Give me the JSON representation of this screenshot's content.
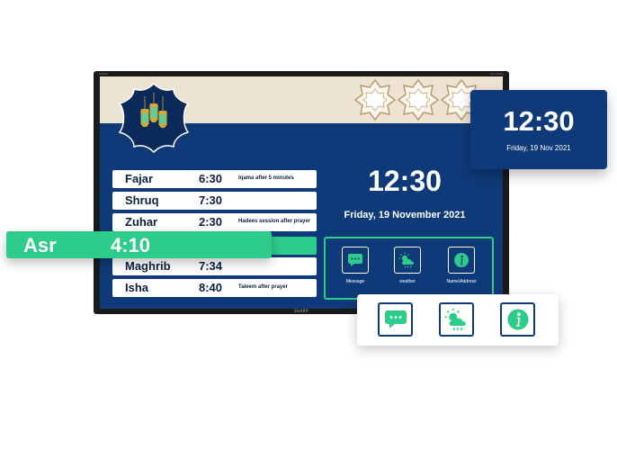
{
  "tv": {
    "brand_top": "SHARP",
    "model_top": "PN-UH701",
    "brand_bottom": "SHARP"
  },
  "prayers": [
    {
      "name": "Fajar",
      "time": "6:30",
      "note": "Iqama after 5 minutes"
    },
    {
      "name": "Shruq",
      "time": "7:30",
      "note": ""
    },
    {
      "name": "Zuhar",
      "time": "2:30",
      "note": "Hadees session after prayer"
    },
    {
      "name": "Maghrib",
      "time": "7:34",
      "note": ""
    },
    {
      "name": "Isha",
      "time": "8:40",
      "note": "Taleem after prayer"
    }
  ],
  "highlight": {
    "name": "Asr",
    "time": "4:10"
  },
  "screen_clock": {
    "time": "12:30",
    "date": "Friday, 19 November 2021"
  },
  "screen_icons": [
    {
      "label": "Message",
      "icon": "message-icon"
    },
    {
      "label": "weather",
      "icon": "weather-icon"
    },
    {
      "label": "Name/Address",
      "icon": "info-icon"
    }
  ],
  "clock_card": {
    "time": "12:30",
    "date": "Friday, 19 Nov 2021"
  },
  "icon_card": [
    {
      "icon": "message-icon"
    },
    {
      "icon": "weather-icon"
    },
    {
      "icon": "info-icon"
    }
  ],
  "colors": {
    "navy": "#0f3a7a",
    "green": "#2ecc8a",
    "beige": "#ede3d2",
    "text_dark": "#0b2240"
  }
}
